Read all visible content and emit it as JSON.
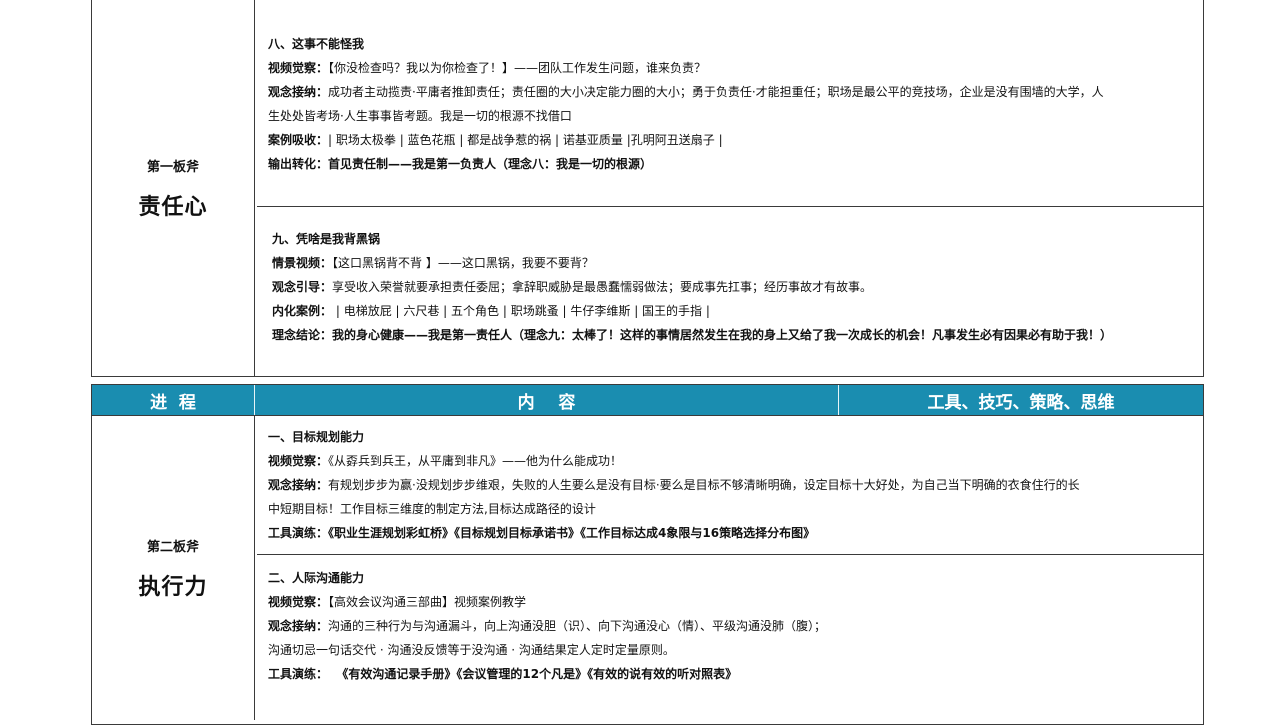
{
  "section1": {
    "stage_label": "第一板斧",
    "stage_name": "责任心",
    "module8": {
      "title": "八、这事不能怪我",
      "video_label": "视频觉察：",
      "video_text": "【你没检查吗？我以为你检查了！】——团队工作发生问题，谁来负责？",
      "concept_label": "观念接纳：",
      "concept_text_1": "成功者主动揽责·平庸者推卸责任；责任圈的大小决定能力圈的大小；勇于负责任·才能担重任；职场是最公平的竞技场，企业是没有围墙的大学，人",
      "concept_text_2": "生处处皆考场·人生事事皆考题。我是一切的根源不找借口",
      "case_label": "案例吸收：",
      "case_text": "| 职场太极拳 | 蓝色花瓶 | 都是战争惹的祸 | 诺基亚质量 |孔明阿丑送扇子 |",
      "output_label": "输出转化：",
      "output_text": "首见责任制——我是第一负责人（理念八：我是一切的根源）"
    },
    "module9": {
      "title": "九、凭啥是我背黑锅",
      "video_label": "情景视频：",
      "video_text": "【这口黑锅背不背 】——这口黑锅，我要不要背？",
      "concept_label": "观念引导：",
      "concept_text": "享受收入荣誉就要承担责任委屈；拿辞职威胁是最愚蠢懦弱做法；要成事先扛事；经历事故才有故事。",
      "case_label": "内化案例：",
      "case_text": " | 电梯放屁 | 六尺巷 | 五个角色 | 职场跳蚤 | 牛仔李维斯 |  国王的手指 |",
      "conclusion_label": "理念结论：",
      "conclusion_text": "我的身心健康——我是第一责任人（理念九：太棒了！这样的事情居然发生在我的身上又给了我一次成长的机会！凡事发生必有因果必有助于我！）"
    }
  },
  "table_header": {
    "col1": "进  程",
    "col2": "内    容",
    "col3": "工具、技巧、策略、思维",
    "header_color": "#1a8db0"
  },
  "section2": {
    "stage_label": "第二板斧",
    "stage_name": "执行力",
    "module1": {
      "title": "一、目标规划能力",
      "video_label": "视频觉察：",
      "video_text": "《从孬兵到兵王，从平庸到非凡》——他为什么能成功！",
      "concept_label": "观念接纳：",
      "concept_text_1": "有规划步步为赢·没规划步步维艰，失败的人生要么是没有目标·要么是目标不够清晰明确，设定目标十大好处，为自己当下明确的衣食住行的长",
      "concept_text_2": "中短期目标！工作目标三维度的制定方法,目标达成路径的设计",
      "tool_label": "工具演练：",
      "tool_text": "《职业生涯规划彩虹桥》《目标规划目标承诺书》《工作目标达成4象限与16策略选择分布图》"
    },
    "module2": {
      "title": "二、人际沟通能力",
      "video_label": "视频觉察：",
      "video_text": "【高效会议沟通三部曲】视频案例教学",
      "concept_label": "观念接纳：",
      "concept_text_1": "沟通的三种行为与沟通漏斗，向上沟通没胆（识）、向下沟通没心（情）、平级沟通没肺（腹）；",
      "concept_text_2": "沟通切忌一句话交代 · 沟通没反馈等于没沟通 · 沟通结果定人定时定量原则。",
      "tool_label": "工具演练：",
      "tool_text": "  《有效沟通记录手册》《会议管理的12个凡是》《有效的说有效的听对照表》"
    }
  }
}
